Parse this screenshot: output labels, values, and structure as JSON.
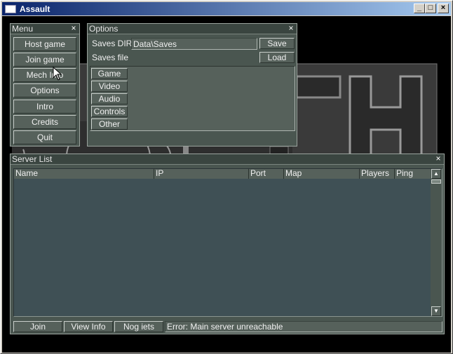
{
  "window": {
    "title": "Assault",
    "controls": {
      "minimize": "_",
      "maximize": "□",
      "close": "×"
    }
  },
  "menu": {
    "title": "Menu",
    "close": "×",
    "items": [
      {
        "label": "Host game"
      },
      {
        "label": "Join game"
      },
      {
        "label": "Mech Info"
      },
      {
        "label": "Options"
      },
      {
        "label": "Intro"
      },
      {
        "label": "Credits"
      },
      {
        "label": "Quit"
      }
    ]
  },
  "options": {
    "title": "Options",
    "close": "×",
    "saves_dir_label": "Saves DIR",
    "saves_dir_value": "Data\\Saves",
    "save_button": "Save",
    "saves_file_label": "Saves file",
    "load_button": "Load",
    "tabs": [
      {
        "label": "Game"
      },
      {
        "label": "Video"
      },
      {
        "label": "Audio"
      },
      {
        "label": "Controls"
      },
      {
        "label": "Other"
      }
    ]
  },
  "server_list": {
    "title": "Server List",
    "close": "×",
    "columns": [
      {
        "label": "Name"
      },
      {
        "label": "IP"
      },
      {
        "label": "Port"
      },
      {
        "label": "Map"
      },
      {
        "label": "Players"
      },
      {
        "label": "Ping"
      }
    ],
    "rows": [],
    "scroll_up": "▲",
    "scroll_down": "▼",
    "join_button": "Join",
    "view_info_button": "View Info",
    "nog_iets_button": "Nog iets",
    "status": "Error: Main server unreachable"
  },
  "icons": {
    "app": "app-window-icon",
    "cursor": "mouse-pointer-icon"
  }
}
